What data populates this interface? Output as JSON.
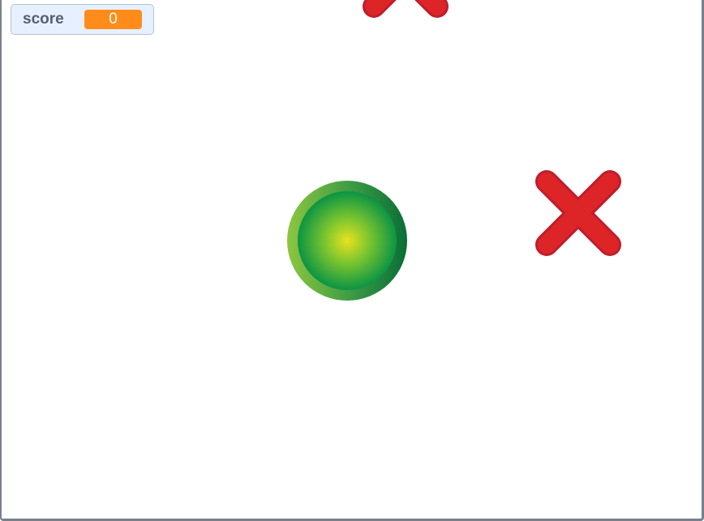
{
  "monitor": {
    "label": "score",
    "value": "0"
  },
  "colors": {
    "monitor_background": "#e6f0ff",
    "monitor_value_background": "#ff8c1a",
    "cross_fill": "#dd2426",
    "cross_stroke": "#be1e2d",
    "orb_outer": "#0b7a3a",
    "orb_inner": "#e5e51d"
  },
  "sprites": [
    {
      "name": "red-cross",
      "icon": "cross-icon"
    },
    {
      "name": "red-cross",
      "icon": "cross-icon"
    },
    {
      "name": "green-orb",
      "icon": "orb-icon"
    }
  ]
}
